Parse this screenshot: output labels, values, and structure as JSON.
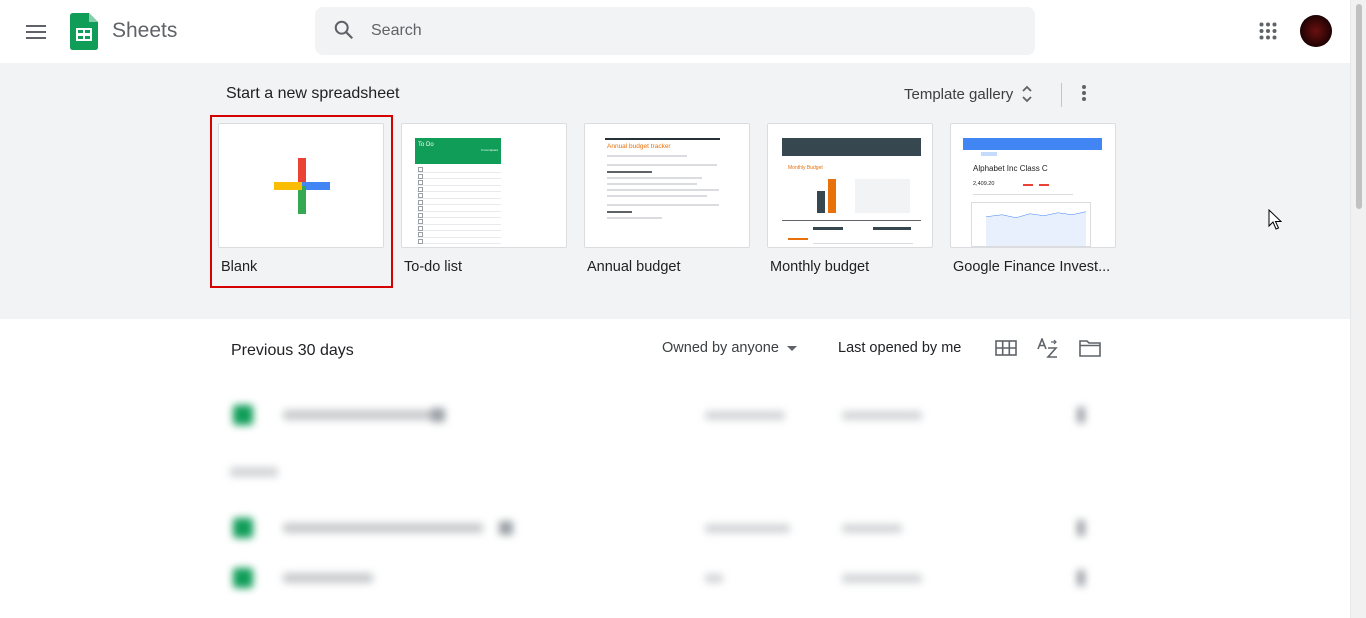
{
  "header": {
    "app_title": "Sheets",
    "search_placeholder": "Search"
  },
  "templates": {
    "heading": "Start a new spreadsheet",
    "gallery_label": "Template gallery",
    "selected": "Blank",
    "items": [
      {
        "label": "Blank"
      },
      {
        "label": "To-do list",
        "thumb_title": "To Do",
        "thumb_subtitle": "0 Completed"
      },
      {
        "label": "Annual budget",
        "thumb_title": "Annual budget tracker"
      },
      {
        "label": "Monthly budget",
        "thumb_title": "Monthly Budget"
      },
      {
        "label": "Google Finance Invest...",
        "thumb_title": "Alphabet Inc Class C",
        "thumb_value": "2,409.20"
      }
    ]
  },
  "recent": {
    "title": "Previous 30 days",
    "owner_filter": "Owned by anyone",
    "sort_label": "Last opened by me"
  },
  "colors": {
    "sheets_green": "#0f9d58",
    "highlight_red": "#d50000",
    "section_bg": "#f1f3f4"
  }
}
